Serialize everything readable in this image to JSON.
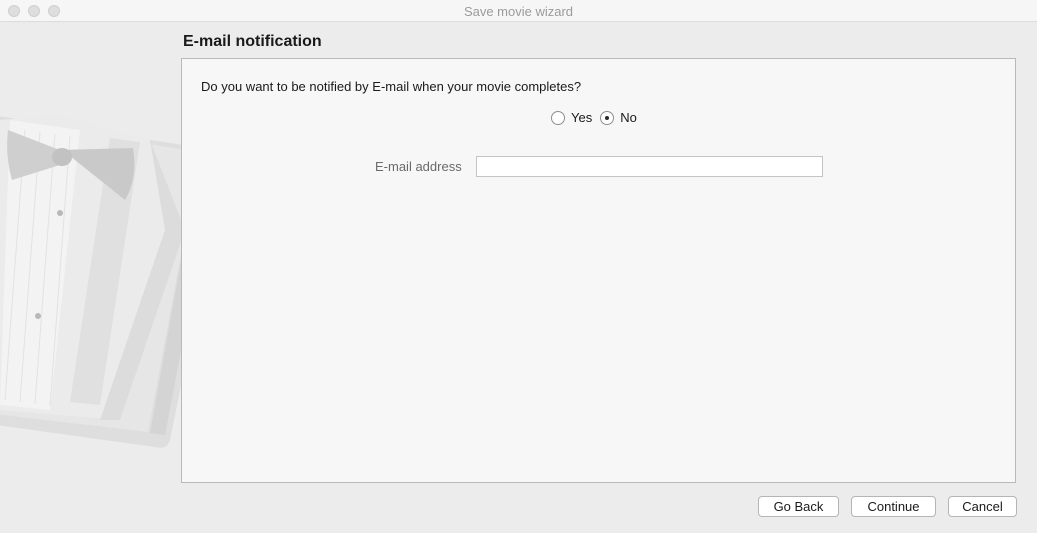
{
  "window": {
    "title": "Save movie wizard"
  },
  "page": {
    "heading": "E-mail notification",
    "question": "Do you want to be notified by E-mail when your movie completes?",
    "notify_options": [
      {
        "label": "Yes",
        "checked": false
      },
      {
        "label": "No",
        "checked": true
      }
    ],
    "email_label": "E-mail address",
    "email_value": ""
  },
  "footer": {
    "back_label": "Go Back",
    "continue_label": "Continue",
    "cancel_label": "Cancel"
  },
  "icons": {
    "sidebar_art": "tuxedo-illustration"
  }
}
